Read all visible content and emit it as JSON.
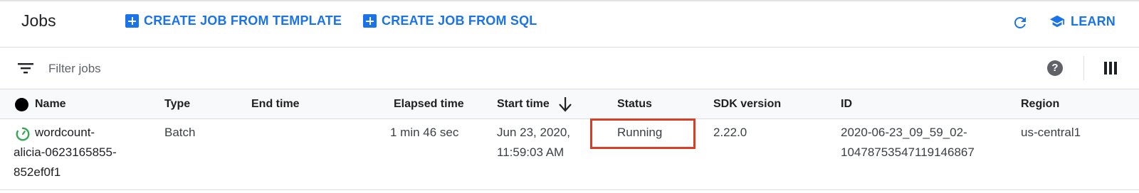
{
  "header": {
    "title": "Jobs",
    "create_template_label": "CREATE JOB FROM TEMPLATE",
    "create_sql_label": "CREATE JOB FROM SQL",
    "learn_label": "LEARN"
  },
  "filter": {
    "placeholder": "Filter jobs"
  },
  "table": {
    "columns": [
      "Name",
      "Type",
      "End time",
      "Elapsed time",
      "Start time",
      "Status",
      "SDK version",
      "ID",
      "Region"
    ],
    "sorted_column": "Start time",
    "sort_direction": "descending",
    "rows": [
      {
        "name_lines": [
          "wordcount-",
          "alicia-0623165855-",
          "852ef0f1"
        ],
        "type": "Batch",
        "end_time": "",
        "elapsed_time": "1 min 46 sec",
        "start_time_lines": [
          "Jun 23, 2020,",
          "11:59:03 AM"
        ],
        "status": "Running",
        "sdk_version": "2.22.0",
        "id_lines": [
          "2020-06-23_09_59_02-",
          "10478753547119146867"
        ],
        "region": "us-central1"
      }
    ]
  },
  "colors": {
    "accent": "#1a73e8",
    "running": "#34a853",
    "highlight": "#d93d26"
  },
  "icons": {
    "create": "add-box-icon",
    "refresh": "refresh-icon",
    "learn": "school-icon",
    "filter": "filter-list-icon",
    "help": "help-icon",
    "columns": "column-view-icon",
    "status": "running-status-icon"
  }
}
